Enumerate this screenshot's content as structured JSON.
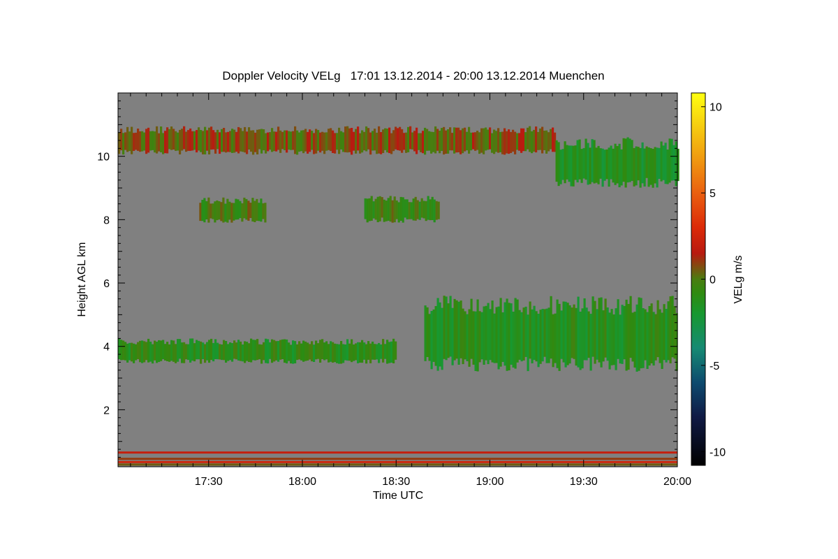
{
  "chart_data": {
    "type": "heatmap",
    "title": "Doppler Velocity VELg   17:01 13.12.2014 - 20:00 13.12.2014 Muenchen",
    "xlabel": "Time UTC",
    "ylabel": "Height AGL km",
    "colorbar_label": "VELg m/s",
    "x_range_hours": [
      17.0167,
      20.0
    ],
    "y_range_km": [
      0.2,
      12.0
    ],
    "colorbar_range": [
      -10.8,
      10.8
    ],
    "x_ticks": [
      {
        "value": 17.5,
        "label": "17:30"
      },
      {
        "value": 18.0,
        "label": "18:00"
      },
      {
        "value": 18.5,
        "label": "18:30"
      },
      {
        "value": 19.0,
        "label": "19:00"
      },
      {
        "value": 19.5,
        "label": "19:30"
      },
      {
        "value": 20.0,
        "label": "20:00"
      }
    ],
    "y_ticks": [
      {
        "value": 2,
        "label": "2"
      },
      {
        "value": 4,
        "label": "4"
      },
      {
        "value": 6,
        "label": "6"
      },
      {
        "value": 8,
        "label": "8"
      },
      {
        "value": 10,
        "label": "10"
      }
    ],
    "colorbar_ticks": [
      {
        "value": 10,
        "label": "10"
      },
      {
        "value": 5,
        "label": "5"
      },
      {
        "value": 0,
        "label": "0"
      },
      {
        "value": -5,
        "label": "-5"
      },
      {
        "value": -10,
        "label": "-10"
      }
    ],
    "colorscale": [
      {
        "v": -10.8,
        "c": "#000000"
      },
      {
        "v": -8,
        "c": "#101a45"
      },
      {
        "v": -6,
        "c": "#0d4a6e"
      },
      {
        "v": -4,
        "c": "#168a73"
      },
      {
        "v": -2,
        "c": "#179830"
      },
      {
        "v": -0.8,
        "c": "#2f8a10"
      },
      {
        "v": 0,
        "c": "#4a7d10"
      },
      {
        "v": 1.5,
        "c": "#b81a10"
      },
      {
        "v": 3,
        "c": "#dc2a08"
      },
      {
        "v": 5,
        "c": "#ea6010"
      },
      {
        "v": 7,
        "c": "#f09a10"
      },
      {
        "v": 9,
        "c": "#f6d010"
      },
      {
        "v": 10.8,
        "c": "#ffff10"
      }
    ],
    "no_data_color": "#808080",
    "cloud_layers": [
      {
        "t0": 17.0167,
        "t1": 18.5,
        "h_bottom": 3.45,
        "h_top": 4.25,
        "mean_velocity": -1.0
      },
      {
        "t0": 18.65,
        "t1": 20.0,
        "h_bottom": 3.2,
        "h_top": 5.6,
        "mean_velocity": -1.2
      },
      {
        "t0": 18.33,
        "t1": 18.73,
        "h_bottom": 7.9,
        "h_top": 8.75,
        "mean_velocity": -0.4
      },
      {
        "t0": 17.45,
        "t1": 17.8,
        "h_bottom": 7.9,
        "h_top": 8.7,
        "mean_velocity": -0.2
      },
      {
        "t0": 17.0167,
        "t1": 19.35,
        "h_bottom": 10.05,
        "h_top": 10.95,
        "mean_velocity": 0.6
      },
      {
        "t0": 19.35,
        "t1": 20.0,
        "h_bottom": 9.0,
        "h_top": 10.6,
        "mean_velocity": -1.5
      }
    ],
    "near_surface_lines": [
      {
        "height": 0.65,
        "velocity": 2.0
      },
      {
        "height": 0.45,
        "velocity": 1.0
      },
      {
        "height": 0.35,
        "velocity": 2.5
      },
      {
        "height": 0.27,
        "velocity": 0.5
      }
    ]
  }
}
